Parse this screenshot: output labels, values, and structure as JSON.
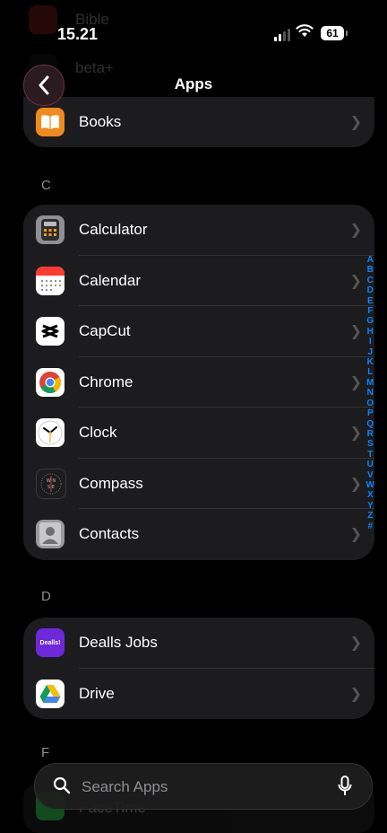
{
  "status": {
    "time": "15.21",
    "battery": "61"
  },
  "ghost_top": {
    "label": "Bible",
    "label2": "beta+"
  },
  "nav": {
    "title": "Apps",
    "back_icon": "chevron-left-icon"
  },
  "groups": {
    "b": {
      "items": [
        {
          "label": "Books",
          "icon": "books-icon"
        }
      ]
    },
    "c": {
      "letter": "C",
      "items": [
        {
          "label": "Calculator",
          "icon": "calculator-icon"
        },
        {
          "label": "Calendar",
          "icon": "calendar-icon"
        },
        {
          "label": "CapCut",
          "icon": "capcut-icon"
        },
        {
          "label": "Chrome",
          "icon": "chrome-icon"
        },
        {
          "label": "Clock",
          "icon": "clock-icon"
        },
        {
          "label": "Compass",
          "icon": "compass-icon"
        },
        {
          "label": "Contacts",
          "icon": "contacts-icon"
        }
      ]
    },
    "d": {
      "letter": "D",
      "items": [
        {
          "label": "Dealls Jobs",
          "icon": "dealls-icon",
          "icon_text": "Dealls!"
        },
        {
          "label": "Drive",
          "icon": "drive-icon"
        }
      ]
    },
    "f": {
      "letter": "F",
      "items": [
        {
          "label": "FaceTime",
          "icon": "facetime-icon"
        }
      ]
    }
  },
  "index_letters": [
    "A",
    "B",
    "C",
    "D",
    "E",
    "F",
    "G",
    "H",
    "I",
    "J",
    "K",
    "L",
    "M",
    "N",
    "O",
    "P",
    "Q",
    "R",
    "S",
    "T",
    "U",
    "V",
    "W",
    "X",
    "Y",
    "Z",
    "#"
  ],
  "search": {
    "placeholder": "Search Apps"
  },
  "colors": {
    "accent": "#0a84ff",
    "group_bg": "#1c1c1e"
  }
}
